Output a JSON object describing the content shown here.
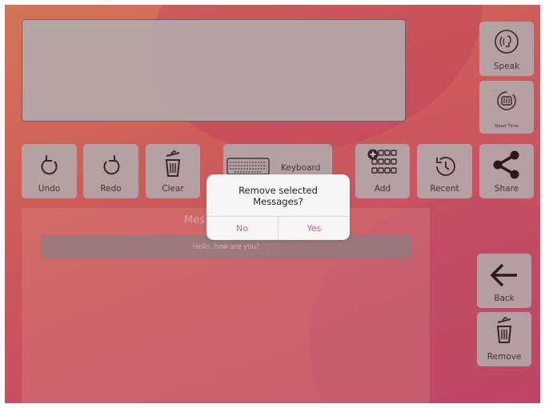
{
  "toolbar": {
    "undo": "Undo",
    "redo": "Redo",
    "clear": "Clear",
    "keyboard": "Keyboard",
    "add": "Add",
    "recent": "Recent",
    "share": "Share"
  },
  "side": {
    "speak": "Speak",
    "need_time": "Need Time",
    "back": "Back",
    "remove": "Remove"
  },
  "messages": {
    "title": "Mes",
    "items": [
      "Hello, how are you?"
    ]
  },
  "dialog": {
    "title": "Remove selected Messages?",
    "no": "No",
    "yes": "Yes",
    "accent": "#d8578a"
  },
  "icons": [
    "undo-icon",
    "redo-icon",
    "trash-icon",
    "keyboard-icon",
    "add-grid-icon",
    "recent-clock-icon",
    "share-icon",
    "speak-icon",
    "need-time-icon",
    "back-arrow-icon",
    "remove-trash-icon"
  ]
}
